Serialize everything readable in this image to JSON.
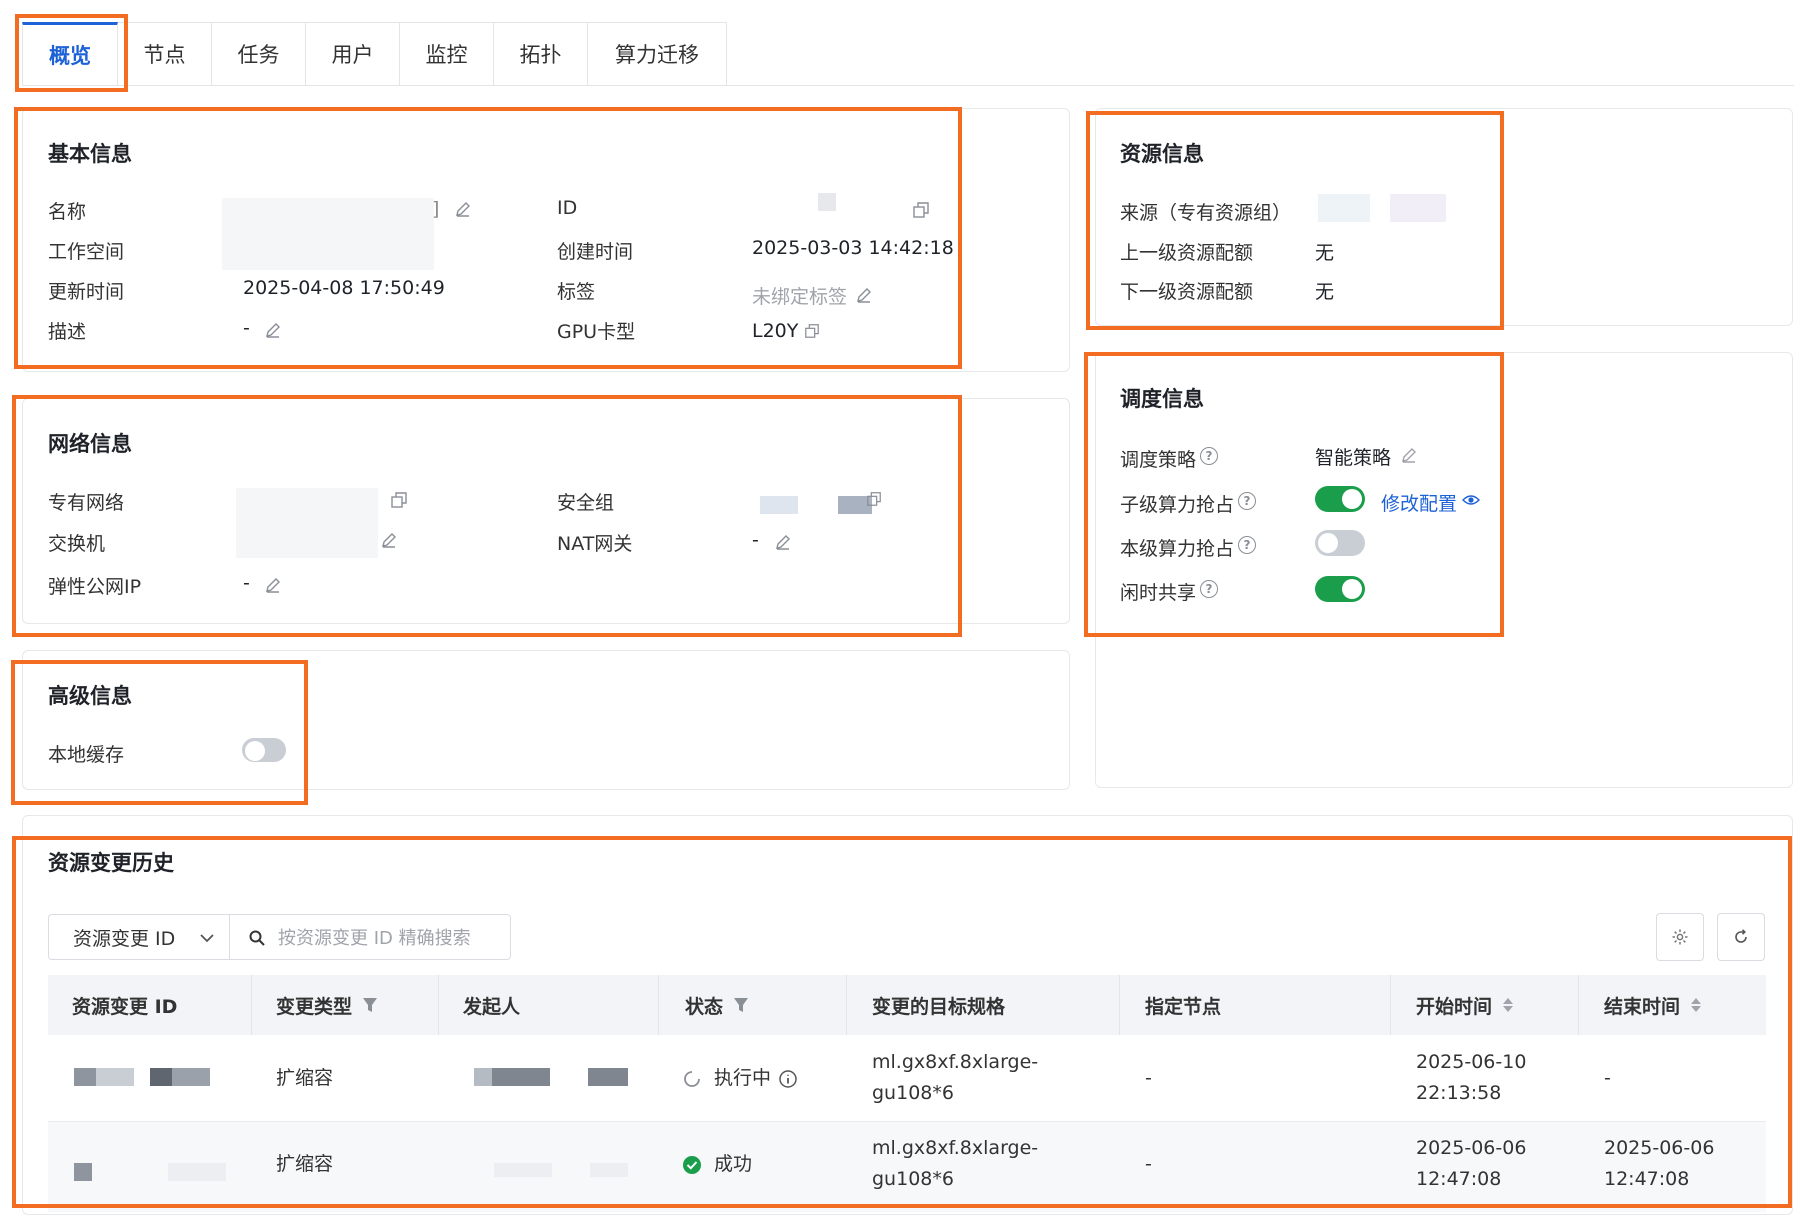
{
  "tabs": [
    "概览",
    "节点",
    "任务",
    "用户",
    "监控",
    "拓扑",
    "算力迁移"
  ],
  "basic_info": {
    "title": "基本信息",
    "name_label": "名称",
    "name_suffix": "]",
    "workspace_label": "工作空间",
    "updated_label": "更新时间",
    "updated_value": "2025-04-08 17:50:49",
    "desc_label": "描述",
    "desc_value": "-",
    "id_label": "ID",
    "created_label": "创建时间",
    "created_value": "2025-03-03 14:42:18",
    "tag_label": "标签",
    "tag_value": "未绑定标签",
    "gpu_label": "GPU卡型",
    "gpu_value": "L20Y"
  },
  "resource_info": {
    "title": "资源信息",
    "source_label": "来源（专有资源组）",
    "parent_quota_label": "上一级资源配额",
    "parent_quota_value": "无",
    "child_quota_label": "下一级资源配额",
    "child_quota_value": "无"
  },
  "network_info": {
    "title": "网络信息",
    "vpc_label": "专有网络",
    "vswitch_label": "交换机",
    "eip_label": "弹性公网IP",
    "eip_value": "-",
    "sg_label": "安全组",
    "nat_label": "NAT网关",
    "nat_value": "-"
  },
  "schedule_info": {
    "title": "调度信息",
    "policy_label": "调度策略",
    "policy_value": "智能策略",
    "child_preempt_label": "子级算力抢占",
    "child_preempt_on": true,
    "modify_config": "修改配置",
    "self_preempt_label": "本级算力抢占",
    "self_preempt_on": false,
    "idle_share_label": "闲时共享",
    "idle_share_on": true
  },
  "advanced_info": {
    "title": "高级信息",
    "local_cache_label": "本地缓存",
    "local_cache_on": false
  },
  "history": {
    "title": "资源变更历史",
    "filter_select": "资源变更 ID",
    "search_placeholder": "按资源变更 ID 精确搜索",
    "columns": [
      "资源变更 ID",
      "变更类型",
      "发起人",
      "状态",
      "变更的目标规格",
      "指定节点",
      "开始时间",
      "结束时间"
    ],
    "rows": [
      {
        "type": "扩缩容",
        "status": "执行中",
        "spec_line1": "ml.gx8xf.8xlarge-",
        "spec_line2": "gu108*6",
        "node": "-",
        "start_line1": "2025-06-10",
        "start_line2": "22:13:58",
        "end_line1": "-",
        "end_line2": ""
      },
      {
        "type": "扩缩容",
        "status": "成功",
        "spec_line1": "ml.gx8xf.8xlarge-",
        "spec_line2": "gu108*6",
        "node": "-",
        "start_line1": "2025-06-06",
        "start_line2": "12:47:08",
        "end_line1": "2025-06-06",
        "end_line2": "12:47:08"
      }
    ]
  },
  "colors": {
    "accent": "#1d62d6",
    "highlight": "#f26d21",
    "toggle_on": "#1a9e4b",
    "toggle_off": "#c9cdd4"
  }
}
